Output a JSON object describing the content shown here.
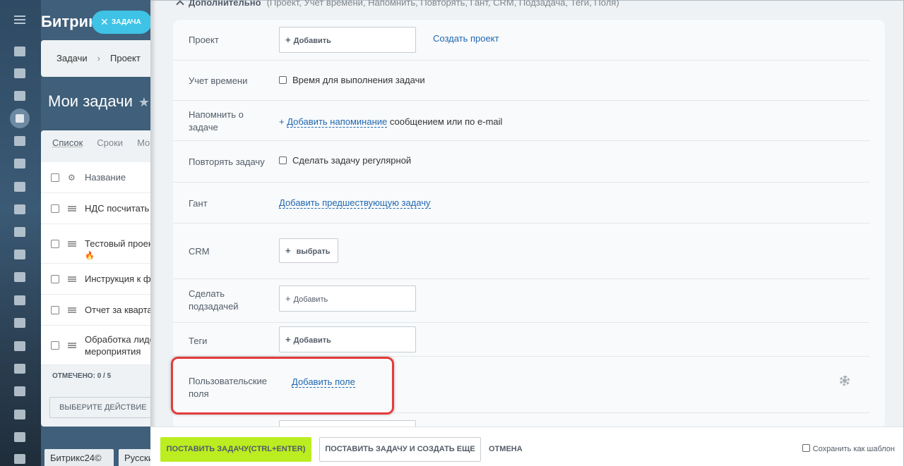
{
  "app": {
    "title": "Битрикс",
    "new_task_pill": "ЗАДАЧА"
  },
  "background": {
    "breadcrumb": [
      "Задачи",
      "Проект"
    ],
    "page_title": "Мои задачи",
    "tabs": [
      "Список",
      "Сроки",
      "Мо"
    ],
    "table_header": "Название",
    "rows": [
      {
        "title": "НДС посчитать"
      },
      {
        "title": "Тестовый проект"
      },
      {
        "title": "Инструкция к ф"
      },
      {
        "title": "Отчет за кварта"
      },
      {
        "title": "Обработка лидо",
        "title2": "мероприятия"
      }
    ],
    "selected_label": "ОТМЕЧЕНО: 0 / 5",
    "action_select": "ВЫБЕРИТЕ ДЕЙСТВИЕ",
    "footer_logo": "Битрикс24©",
    "footer_lang": "Русский"
  },
  "form": {
    "section_title": "Дополнительно",
    "section_hint": "(Проект, Учет времени, Напомнить, Повторять, Гант, CRM, Подзадача, Теги, Поля)",
    "project": {
      "label": "Проект",
      "input": "Добавить",
      "link": "Создать проект"
    },
    "time": {
      "label": "Учет времени",
      "checkbox": "Время для выполнения задачи"
    },
    "remind": {
      "label_line1": "Напомнить о",
      "label_line2": "задаче",
      "prefix": "+",
      "link": "Добавить напоминание",
      "suffix": "сообщением или по e-mail"
    },
    "repeat": {
      "label": "Повторять задачу",
      "checkbox": "Сделать задачу регулярной"
    },
    "gantt": {
      "label": "Гант",
      "link": "Добавить предшествующую задачу"
    },
    "crm": {
      "label": "CRM",
      "button": "выбрать"
    },
    "subtask": {
      "label_line1": "Сделать",
      "label_line2": "подзадачей",
      "input": "Добавить"
    },
    "tags": {
      "label": "Теги",
      "input": "Добавить"
    },
    "user_fields": {
      "label_line1": "Пользовательские",
      "label_line2": "поля",
      "link": "Добавить поле"
    }
  },
  "footer": {
    "primary": "ПОСТАВИТЬ ЗАДАЧУ(CTRL+ENTER)",
    "secondary": "ПОСТАВИТЬ ЗАДАЧУ И СОЗДАТЬ ЕЩЕ",
    "cancel": "ОТМЕНА",
    "template": "Сохранить как шаблон"
  },
  "colors": {
    "accent_green": "#bbed21",
    "link_blue": "#2067b0",
    "highlight_red": "#e53b3b",
    "pill_blue": "#3ec3e6"
  }
}
